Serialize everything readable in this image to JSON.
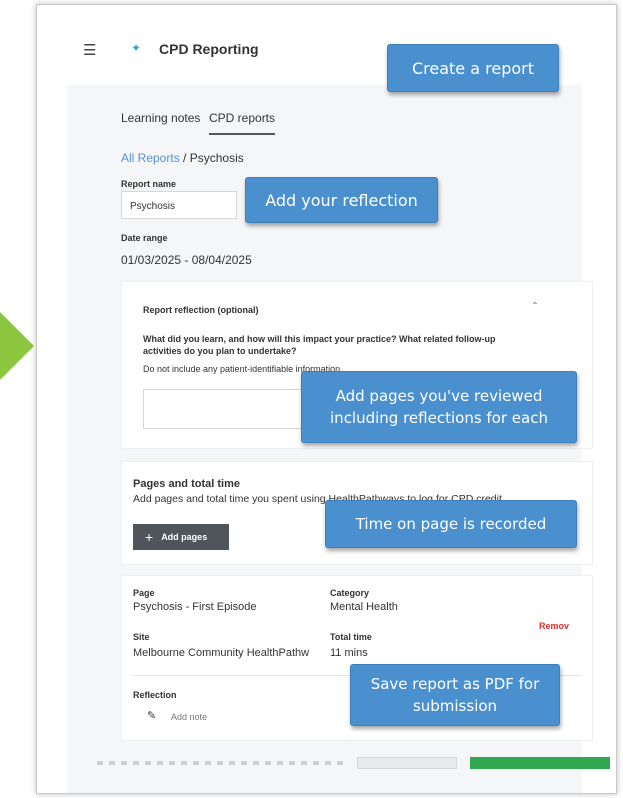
{
  "app": {
    "title": "CPD Reporting",
    "menu_icon": "hamburger-icon",
    "logo_icon": "healthpathways-logo-icon"
  },
  "tabs": [
    {
      "label": "Learning notes"
    },
    {
      "label": "CPD reports",
      "active": true
    }
  ],
  "breadcrumb": {
    "link": "All Reports",
    "separator": "/",
    "current": "Psychosis"
  },
  "report": {
    "name_label": "Report name",
    "name_value": "Psychosis",
    "date_label": "Date range",
    "date_value": "01/03/2025 - 08/04/2025"
  },
  "reflection_card": {
    "title": "Report reflection (optional)",
    "question": "What did you learn, and how will this impact your practice? What related follow-up activities do you plan to undertake?",
    "note": "Do not include any patient-identifiable information.",
    "chevron_icon": "chevron-up-icon"
  },
  "pages_card": {
    "title": "Pages and total time",
    "description": "Add pages and total time you spent using HealthPathways to log for CPD credit.",
    "add_button": "Add pages",
    "add_icon": "plus-icon"
  },
  "page_entry": {
    "page_label": "Page",
    "page_value": "Psychosis - First Episode",
    "category_label": "Category",
    "category_value": "Mental Health",
    "site_label": "Site",
    "site_value": "Melbourne Community HealthPathw",
    "time_label": "Total time",
    "time_value": "11 mins",
    "remove_label": "Remoᴠ",
    "reflection_label": "Reflection",
    "add_note_label": "Add note",
    "pencil_icon": "pencil-icon"
  },
  "callouts": {
    "create": "Create a report",
    "reflection": "Add your reflection",
    "pages_line1": "Add pages you've reviewed",
    "pages_line2": "including reflections for each",
    "time": "Time on page is recorded",
    "save_line1": "Save report as PDF for",
    "save_line2": "submission"
  },
  "colors": {
    "callout": "#4a90cf",
    "arrow": "#8dc63f",
    "link": "#5b8fd0",
    "remove": "#e03030",
    "primary_button": "#2fa84f"
  }
}
